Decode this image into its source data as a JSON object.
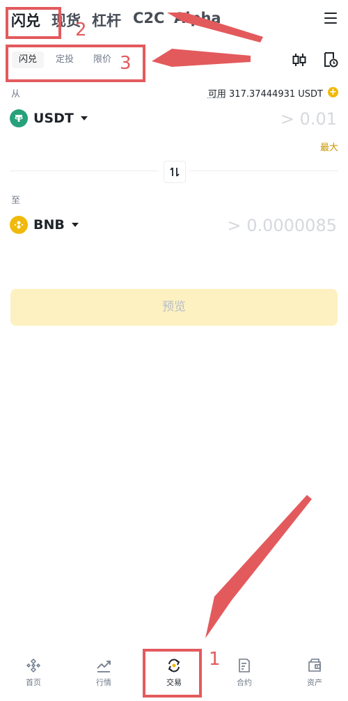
{
  "top_tabs": [
    "闪兑",
    "现货",
    "杠杆",
    "C2C",
    "Alpha"
  ],
  "sub_tabs": [
    "闪兑",
    "定投",
    "限价"
  ],
  "from": {
    "label": "从",
    "available_label": "可用",
    "available_value": "317.37444931 USDT",
    "coin": "USDT",
    "amount_placeholder": "> 0.01",
    "max_label": "最大"
  },
  "to": {
    "label": "至",
    "coin": "BNB",
    "amount_placeholder": "> 0.0000085"
  },
  "preview_button": "预览",
  "bottom_nav": [
    "首页",
    "行情",
    "交易",
    "合约",
    "资产"
  ],
  "annotations": [
    "1",
    "2",
    "3"
  ],
  "colors": {
    "accent": "#f0b90b",
    "annotation_red": "#e35a5d",
    "usdt_green": "#26a17b",
    "preview_bg": "#fdf1c2"
  }
}
